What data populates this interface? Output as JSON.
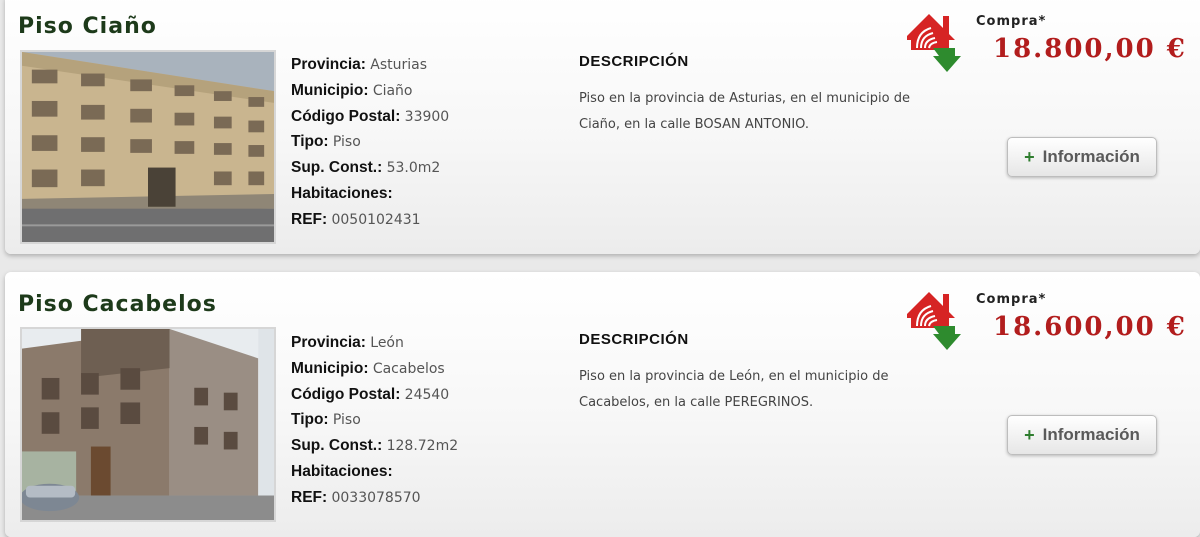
{
  "colors": {
    "title": "#1d3a1a",
    "price": "#b21d1d",
    "plus_icon": "#2f7d2f",
    "logo_red": "#d62424",
    "logo_green": "#2e8b2e"
  },
  "listings": [
    {
      "title": "Piso Ciaño",
      "fields": {
        "provincia": {
          "label": "Provincia:",
          "value": "Asturias"
        },
        "municipio": {
          "label": "Municipio:",
          "value": "Ciaño"
        },
        "codigo_postal": {
          "label": "Código Postal:",
          "value": "33900"
        },
        "tipo": {
          "label": "Tipo:",
          "value": "Piso"
        },
        "sup_const": {
          "label": "Sup. Const.:",
          "value": "53.0m2"
        },
        "habitaciones": {
          "label": "Habitaciones:",
          "value": ""
        },
        "ref": {
          "label": "REF:",
          "value": "0050102431"
        }
      },
      "description_heading": "DESCRIPCIÓN",
      "description": "Piso en la provincia de Asturias, en el municipio de Ciaño, en la calle BOSAN ANTONIO.",
      "buy_label": "Compra*",
      "price": "18.800,00 €",
      "button": {
        "icon": "plus-icon",
        "label": "Información"
      }
    },
    {
      "title": "Piso Cacabelos",
      "fields": {
        "provincia": {
          "label": "Provincia:",
          "value": "León"
        },
        "municipio": {
          "label": "Municipio:",
          "value": "Cacabelos"
        },
        "codigo_postal": {
          "label": "Código Postal:",
          "value": "24540"
        },
        "tipo": {
          "label": "Tipo:",
          "value": "Piso"
        },
        "sup_const": {
          "label": "Sup. Const.:",
          "value": "128.72m2"
        },
        "habitaciones": {
          "label": "Habitaciones:",
          "value": ""
        },
        "ref": {
          "label": "REF:",
          "value": "0033078570"
        }
      },
      "description_heading": "DESCRIPCIÓN",
      "description": "Piso en la provincia de León, en el municipio de Cacabelos, en la calle PEREGRINOS.",
      "buy_label": "Compra*",
      "price": "18.600,00 €",
      "button": {
        "icon": "plus-icon",
        "label": "Información"
      }
    }
  ]
}
